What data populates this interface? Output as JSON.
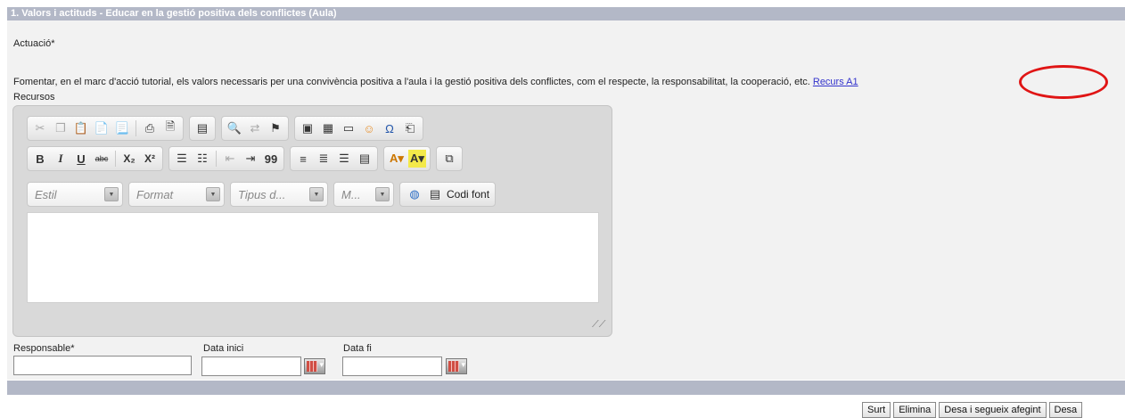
{
  "section": {
    "title": "1. Valors i actituds - Educar en la gestió positiva dels conflictes (Aula)"
  },
  "actuacio": {
    "label": "Actuació*",
    "text": "Fomentar, en el marc d'acció tutorial, els valors necessaris per una convivència positiva a l'aula i la gestió positiva dels conflictes, com el respecte, la responsabilitat, la cooperació, etc.",
    "link": "Recurs A1"
  },
  "recursos": {
    "label": "Recursos",
    "toolbar": {
      "row1": [
        "cut-icon",
        "copy-icon",
        "paste-icon",
        "paste-text-icon",
        "paste-word-icon",
        "print-icon",
        "preview-icon",
        "template-icon",
        "find-icon",
        "replace-icon",
        "anchor-icon",
        "image-icon",
        "table-icon",
        "horizontal-rule-icon",
        "smiley-icon",
        "special-char-icon",
        "page-break-icon"
      ],
      "format_buttons": {
        "bold": "B",
        "italic": "I",
        "underline": "U",
        "strike": "abc",
        "subscript": "X₂",
        "superscript": "X²",
        "blockquote": "99",
        "special_char": "Ω"
      },
      "combos": {
        "style": "Estil",
        "format": "Format",
        "font": "Tipus d...",
        "size": "M..."
      },
      "source_label": "Codi font"
    }
  },
  "fields": {
    "responsable": {
      "label": "Responsable*",
      "value": ""
    },
    "data_inici": {
      "label": "Data inici",
      "value": ""
    },
    "data_fi": {
      "label": "Data fi",
      "value": ""
    }
  },
  "buttons": {
    "surt": "Surt",
    "elimina": "Elimina",
    "desa_segueix": "Desa i segueix afegint",
    "desa": "Desa"
  },
  "colors": {
    "header_bar": "#b3b8c7",
    "callout": "#e01515",
    "link": "#3333cc"
  }
}
